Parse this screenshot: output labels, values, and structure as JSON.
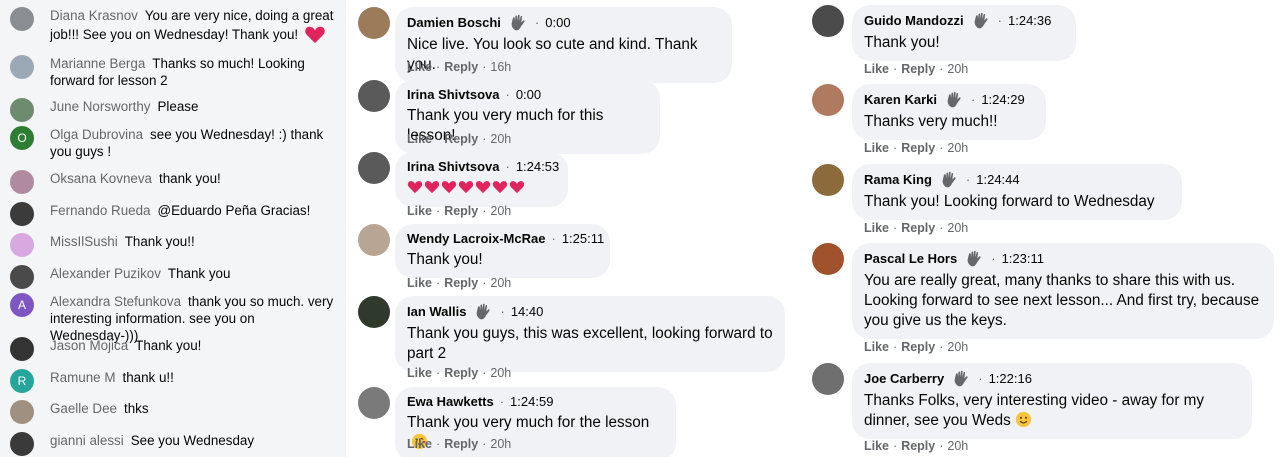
{
  "live_chat": [
    {
      "name": "Diana Krasnov",
      "message": "You are very nice, doing a great job!!! See you on Wednesday! Thank you!",
      "avatar_color": "#8a8d91",
      "has_heart": true
    },
    {
      "name": "Marianne Berga",
      "message": "Thanks so much! Looking forward for lesson 2",
      "avatar_color": "#9aa9b5"
    },
    {
      "name": "June Norsworthy",
      "message": "Please",
      "avatar_color": "#6e8a6f"
    },
    {
      "name": "Olga Dubrovina",
      "message": "see you Wednesday! :) thank you guys !",
      "avatar_color": "#2e7d32",
      "avatar_letter": "O"
    },
    {
      "name": "Oksana Kovneva",
      "message": "thank you!",
      "avatar_color": "#b08aa0"
    },
    {
      "name": "Fernando Rueda",
      "message": "@Eduardo Peña Gracias!",
      "avatar_color": "#3b3b3b"
    },
    {
      "name": "MissIlSushi",
      "message": "Thank you!!",
      "avatar_color": "#d9a8e0"
    },
    {
      "name": "Alexander Puzikov",
      "message": "Thank you",
      "avatar_color": "#4a4a4a"
    },
    {
      "name": "Alexandra Stefunkova",
      "message": "thank you so much. very interesting information. see you on Wednesday-)))",
      "avatar_color": "#7e57c2",
      "avatar_letter": "A"
    },
    {
      "name": "Jason Mojica",
      "message": "Thank you!",
      "avatar_color": "#333333"
    },
    {
      "name": "Ramune M",
      "message": "thank u!!",
      "avatar_color": "#26a69a",
      "avatar_letter": "R"
    },
    {
      "name": "Gaelle Dee",
      "message": "thks",
      "avatar_color": "#a09080"
    },
    {
      "name": "gianni alessi",
      "message": "See you Wednesday",
      "avatar_color": "#3a3a3a"
    }
  ],
  "comments": [
    {
      "name": "Damien Boschi",
      "badge": true,
      "time": "0:00",
      "text": "Nice live. You look so cute and kind. Thank you.",
      "like": "Like",
      "reply": "Reply",
      "age": "16h",
      "avatar_color": "#9c7b5a"
    },
    {
      "name": "Irina Shivtsova",
      "badge": false,
      "time": "0:00",
      "text": "Thank you very much for this lesson!",
      "like": "Like",
      "reply": "Reply",
      "age": "20h",
      "avatar_color": "#5a5a5a"
    },
    {
      "name": "Irina Shivtsova",
      "badge": false,
      "time": "1:24:53",
      "text": "",
      "hearts": 7,
      "like": "Like",
      "reply": "Reply",
      "age": "20h",
      "avatar_color": "#5a5a5a"
    },
    {
      "name": "Wendy Lacroix-McRae",
      "badge": false,
      "time": "1:25:11",
      "text": "Thank you!",
      "like": "Like",
      "reply": "Reply",
      "age": "20h",
      "avatar_color": "#b9a593"
    },
    {
      "name": "Ian Wallis",
      "badge": true,
      "time": "14:40",
      "text": "Thank you guys, this was excellent, looking forward to part 2",
      "like": "Like",
      "reply": "Reply",
      "age": "20h",
      "avatar_color": "#2f3a2c"
    },
    {
      "name": "Ewa Hawketts",
      "badge": false,
      "time": "1:24:59",
      "text": "Thank you very much for the lesson",
      "emoji": "kiss",
      "like": "Like",
      "reply": "Reply",
      "age": "20h",
      "avatar_color": "#7a7a7a"
    },
    {
      "name": "Guido Mandozzi",
      "badge": true,
      "time": "1:24:36",
      "text": "Thank you!",
      "like": "Like",
      "reply": "Reply",
      "age": "20h",
      "avatar_color": "#4b4b4b"
    },
    {
      "name": "Karen Karki",
      "badge": true,
      "time": "1:24:29",
      "text": "Thanks very much!!",
      "like": "Like",
      "reply": "Reply",
      "age": "20h",
      "avatar_color": "#b07a60"
    },
    {
      "name": "Rama King",
      "badge": true,
      "time": "1:24:44",
      "text": "Thank you! Looking forward to Wednesday",
      "like": "Like",
      "reply": "Reply",
      "age": "20h",
      "avatar_color": "#8c6a3c"
    },
    {
      "name": "Pascal Le Hors",
      "badge": true,
      "time": "1:23:11",
      "text": "You are really great, many thanks to share this with us. Looking forward to see next lesson... And first try, because you give us the keys.",
      "like": "Like",
      "reply": "Reply",
      "age": "20h",
      "avatar_color": "#a0522d"
    },
    {
      "name": "Joe Carberry",
      "badge": true,
      "time": "1:22:16",
      "text": "Thanks Folks, very interesting video - away for my dinner, see you Weds",
      "emoji": "smile",
      "like": "Like",
      "reply": "Reply",
      "age": "20h",
      "avatar_color": "#6f6f6f"
    }
  ],
  "colors": {
    "bubble": "#f0f2f5",
    "secondary_text": "#65676b",
    "heart": "#e0245e"
  },
  "icons": {
    "badge": "waving-hand-icon",
    "heart": "heart-emoji-icon",
    "kiss": "kissing-face-emoji-icon",
    "smile": "smiling-face-emoji-icon"
  }
}
